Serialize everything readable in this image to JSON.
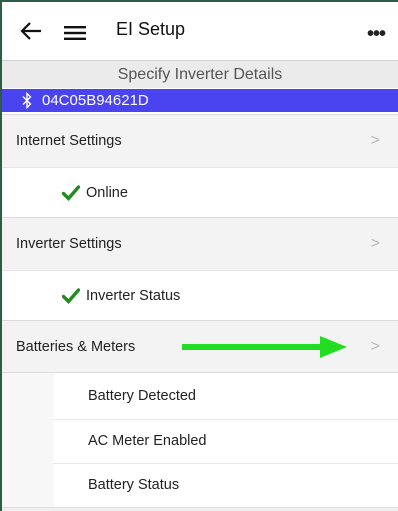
{
  "header": {
    "title": "EI Setup",
    "back_icon": "back-arrow-icon",
    "menu_icon": "hamburger-menu-icon",
    "more_icon": "more-options-icon",
    "more_glyph": "•••"
  },
  "subheader": {
    "title": "Specify Inverter Details"
  },
  "device": {
    "icon": "bluetooth-icon",
    "id": "04C05B94621D",
    "bar_color": "#4a44f0"
  },
  "sections": {
    "internet": {
      "label": "Internet Settings",
      "status": "Online"
    },
    "inverter": {
      "label": "Inverter Settings",
      "status": "Inverter Status"
    },
    "batteries": {
      "label": "Batteries & Meters",
      "items": [
        "Battery Detected",
        "AC Meter Enabled",
        "Battery Status"
      ]
    }
  },
  "chevron_glyph": ">",
  "colors": {
    "check": "#1e8c1e",
    "annotation_arrow": "#22dd22",
    "frame": "#2e5d47"
  }
}
